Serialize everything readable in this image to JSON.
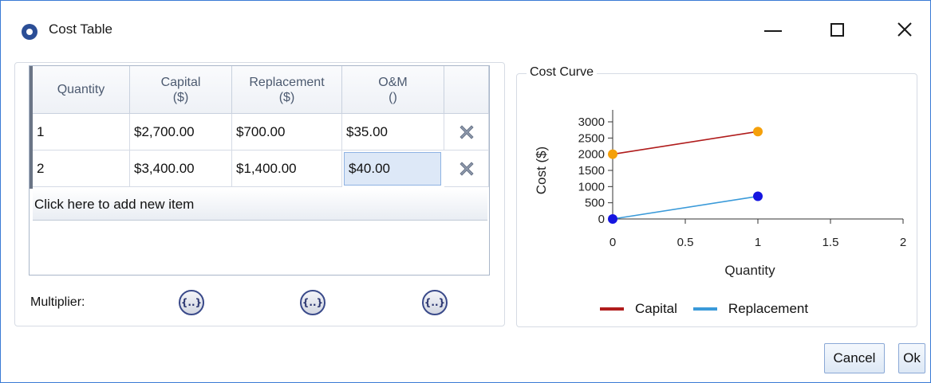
{
  "window": {
    "title": "Cost Table",
    "icon": "app-logo-icon",
    "controls": [
      "minimize-icon",
      "maximize-icon",
      "close-icon"
    ],
    "close_glyph": "✕"
  },
  "table": {
    "columns": [
      {
        "label": "Quantity",
        "unit": ""
      },
      {
        "label": "Capital",
        "unit": "($)"
      },
      {
        "label": "Replacement",
        "unit": "($)"
      },
      {
        "label": "O&M",
        "unit": "()"
      }
    ],
    "rows": [
      {
        "quantity": "1",
        "capital": "$2,700.00",
        "replacement": "$700.00",
        "om": "$35.00"
      },
      {
        "quantity": "2",
        "capital": "$3,400.00",
        "replacement": "$1,400.00",
        "om": "$40.00"
      }
    ],
    "add_row_text": "Click here to add new item",
    "delete_icon": "delete-x-icon"
  },
  "multiplier": {
    "label": "Multiplier:",
    "button_text": "{..}"
  },
  "chart_panel": {
    "label": "Cost Curve"
  },
  "chart_data": {
    "type": "line",
    "xlabel": "Quantity",
    "ylabel": "Cost ($)",
    "xlim": [
      0,
      2
    ],
    "ylim": [
      0,
      3000
    ],
    "xticks": [
      "0",
      "0.5",
      "1",
      "1.5",
      "2"
    ],
    "yticks": [
      "0",
      "500",
      "1000",
      "1500",
      "2000",
      "2500",
      "3000"
    ],
    "legend": "bottom",
    "series": [
      {
        "name": "Capital",
        "color": "#b01c1c",
        "marker_color": "#f5a00a",
        "x": [
          0,
          1
        ],
        "y": [
          2000,
          2700
        ]
      },
      {
        "name": "Replacement",
        "color": "#3a9ad9",
        "marker_color": "#1515e0",
        "x": [
          0,
          1
        ],
        "y": [
          0,
          700
        ]
      }
    ]
  },
  "buttons": {
    "cancel": "Cancel",
    "ok": "Ok"
  }
}
